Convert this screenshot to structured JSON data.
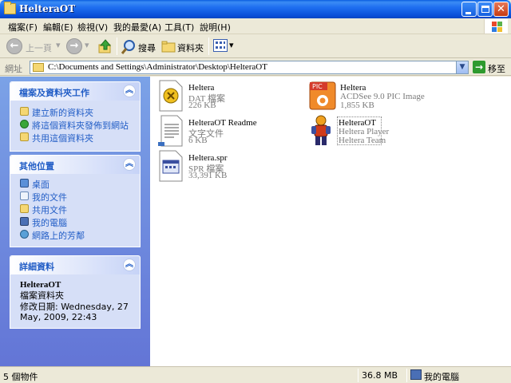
{
  "window": {
    "title": "HelteraOT"
  },
  "menu": [
    "檔案(F)",
    "編輯(E)",
    "檢視(V)",
    "我的最愛(A)",
    "工具(T)",
    "說明(H)"
  ],
  "toolbar": {
    "back_label": "上一頁",
    "search_label": "搜尋",
    "folders_label": "資料夾"
  },
  "address": {
    "label": "網址",
    "path": "C:\\Documents and Settings\\Administrator\\Desktop\\HelteraOT",
    "go_label": "移至"
  },
  "tasks": {
    "file_folder": {
      "title": "檔案及資料夾工作",
      "items": [
        "建立新的資料夾",
        "將這個資料夾發佈到網站",
        "共用這個資料夾"
      ]
    },
    "other_places": {
      "title": "其他位置",
      "items": [
        "桌面",
        "我的文件",
        "共用文件",
        "我的電腦",
        "網路上的芳鄰"
      ]
    },
    "details": {
      "title": "詳細資料",
      "name": "HelteraOT",
      "type": "檔案資料夾",
      "modified": "修改日期: Wednesday, 27 May, 2009, 22:43"
    }
  },
  "files": [
    {
      "name": "Heltera",
      "desc": "DAT 檔案",
      "size": "226 KB",
      "icon": "dat-file-icon"
    },
    {
      "name": "Heltera",
      "desc": "ACDSee 9.0 PIC Image",
      "size": "1,855 KB",
      "icon": "pic-image-icon"
    },
    {
      "name": "HelteraOT Readme",
      "desc": "文字文件",
      "size": "6 KB",
      "icon": "text-document-icon"
    },
    {
      "name": "HelteraOT",
      "desc": "Heltera Player",
      "size": "Heltera Team",
      "icon": "game-character-icon"
    },
    {
      "name": "Heltera.spr",
      "desc": "SPR 檔案",
      "size": "33,391 KB",
      "icon": "spr-file-icon"
    }
  ],
  "status": {
    "objects": "5 個物件",
    "size": "36.8 MB",
    "location": "我的電腦"
  },
  "colors": {
    "titlebar": "#1f6ff0",
    "taskpane": "#6f8ce0",
    "link": "#215dc6"
  }
}
